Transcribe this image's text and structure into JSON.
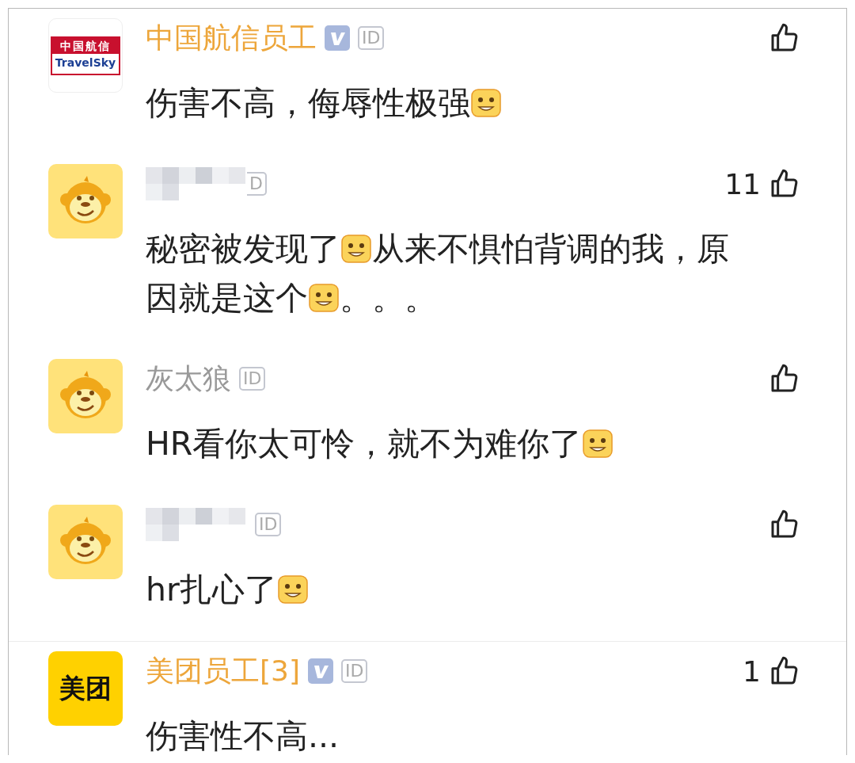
{
  "comments": [
    {
      "avatar": {
        "kind": "travelsky",
        "lines": [
          "中国航信",
          "TravelSky"
        ]
      },
      "name": "中国航信员工",
      "verified": true,
      "id_badge": "ID",
      "body": [
        {
          "kind": "text",
          "text": "伤害不高，侮辱性极强"
        },
        {
          "kind": "emoji"
        }
      ]
    },
    {
      "avatar": {
        "kind": "monkey"
      },
      "name_blurred": true,
      "verified": false,
      "id_badge": "D",
      "likes": "11",
      "body": [
        {
          "kind": "text",
          "text": "秘密被发现了"
        },
        {
          "kind": "emoji"
        },
        {
          "kind": "text",
          "text": "从来不惧怕背调的我，原"
        },
        {
          "kind": "break"
        },
        {
          "kind": "text",
          "text": "因就是这个"
        },
        {
          "kind": "emoji"
        },
        {
          "kind": "text",
          "text": "。。。"
        }
      ]
    },
    {
      "avatar": {
        "kind": "monkey"
      },
      "name": "灰太狼",
      "verified": false,
      "id_badge": "ID",
      "body": [
        {
          "kind": "text",
          "text": "HR看你太可怜，就不为难你了"
        },
        {
          "kind": "emoji"
        }
      ]
    },
    {
      "avatar": {
        "kind": "monkey"
      },
      "name_blurred": true,
      "verified": false,
      "id_badge": "ID",
      "body": [
        {
          "kind": "text",
          "text": "hr扎心了"
        },
        {
          "kind": "emoji"
        }
      ]
    },
    {
      "avatar": {
        "kind": "meituan",
        "lines": [
          "美团"
        ]
      },
      "name": "美团员工[3]",
      "verified": true,
      "id_badge": "ID",
      "likes": "1",
      "body": [
        {
          "kind": "text",
          "text": "伤害性不高..."
        }
      ]
    }
  ]
}
